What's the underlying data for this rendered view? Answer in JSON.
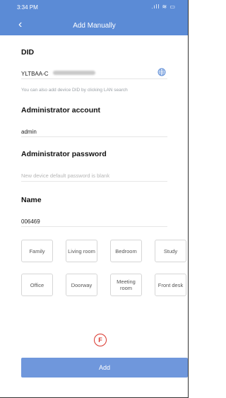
{
  "status_bar": {
    "time": "3:34 PM",
    "icons": ".ıll ≋ ▭"
  },
  "header": {
    "back_icon": "chevron-left-icon",
    "title": "Add Manually"
  },
  "did": {
    "label": "DID",
    "value": "YLTBAA-C",
    "hint": "You can also add device DID by clicking LAN search",
    "icon": "globe-icon"
  },
  "admin_account": {
    "label": "Administrator account",
    "value": "admin"
  },
  "admin_password": {
    "label": "Administrator password",
    "placeholder": "New device default password is blank"
  },
  "name": {
    "label": "Name",
    "value": "006469"
  },
  "room_tags": [
    "Family",
    "Living room",
    "Bedroom",
    "Study",
    "Office",
    "Doorway",
    "Meeting room",
    "Front desk"
  ],
  "badge_text": "F",
  "add_button": "Add",
  "colors": {
    "header": "#5b8bd6",
    "button": "#6f97dc",
    "badge": "#d9342b"
  }
}
